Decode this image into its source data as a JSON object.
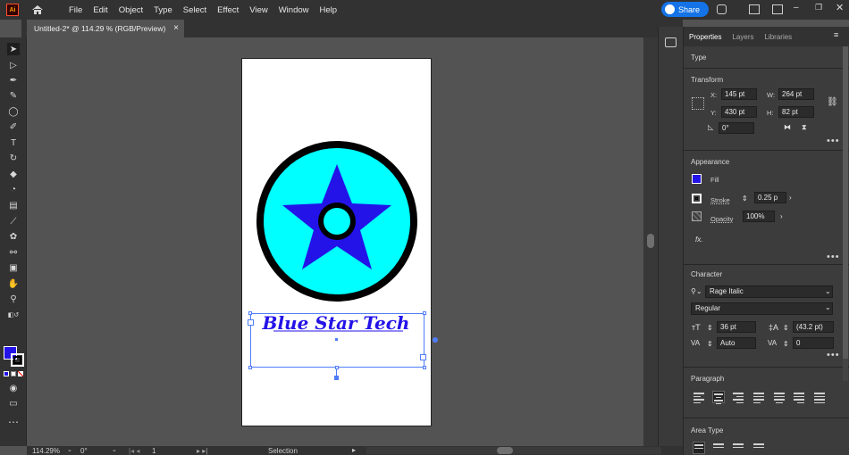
{
  "app": {
    "logo_text": "Ai"
  },
  "menu": [
    "File",
    "Edit",
    "Object",
    "Type",
    "Select",
    "Effect",
    "View",
    "Window",
    "Help"
  ],
  "share_label": "Share",
  "document_tab": {
    "title": "Untitled-2* @ 114.29 % (RGB/Preview)",
    "close": "×"
  },
  "artwork": {
    "logo_text": "Blue Star Tech",
    "colors": {
      "cyan": "#00ffff",
      "blue": "#2313e8",
      "black": "#000000"
    }
  },
  "panel": {
    "tabs": [
      "Properties",
      "Layers",
      "Libraries"
    ],
    "type_section": "Type",
    "transform": {
      "title": "Transform",
      "x_label": "X:",
      "x": "145 pt",
      "y_label": "Y:",
      "y": "430 pt",
      "w_label": "W:",
      "w": "264 pt",
      "h_label": "H:",
      "h": "82 pt",
      "rotate": "0°"
    },
    "appearance": {
      "title": "Appearance",
      "fill": "Fill",
      "stroke": "Stroke",
      "stroke_value": "0.25 p",
      "opacity": "Opacity",
      "opacity_value": "100%",
      "fx": "fx."
    },
    "character": {
      "title": "Character",
      "font": "Rage Italic",
      "style": "Regular",
      "size": "36 pt",
      "leading": "(43.2 pt)",
      "kerning": "Auto",
      "tracking": "0"
    },
    "paragraph": {
      "title": "Paragraph"
    },
    "area_type": {
      "title": "Area Type"
    }
  },
  "status": {
    "zoom": "114.29%",
    "rotation": "0°",
    "artboard": "1",
    "tool": "Selection"
  },
  "colors": {
    "accent": "#1473e6",
    "fill_swatch": "#2313e8"
  }
}
